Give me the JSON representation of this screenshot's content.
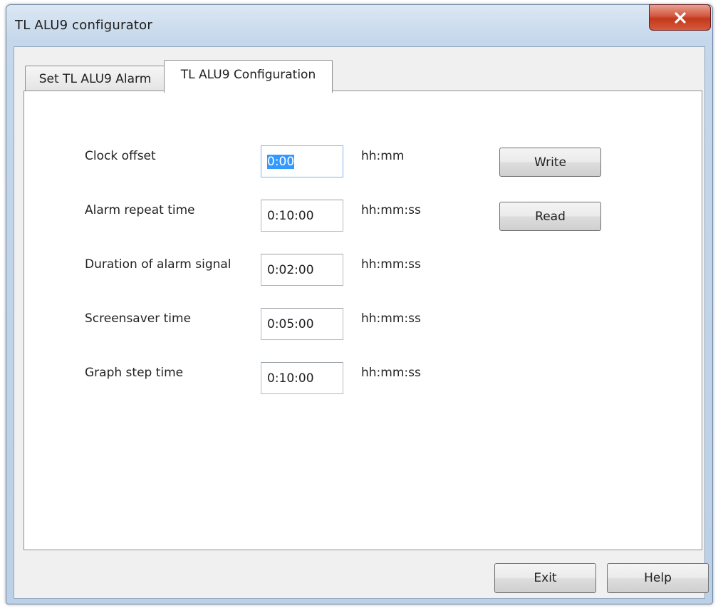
{
  "window": {
    "title": "TL ALU9 configurator"
  },
  "tabs": [
    {
      "label": "Set TL ALU9 Alarm",
      "active": false
    },
    {
      "label": "TL ALU9 Configuration",
      "active": true
    }
  ],
  "config": {
    "rows": [
      {
        "label": "Clock offset",
        "value": "0:00",
        "unit": "hh:mm"
      },
      {
        "label": "Alarm repeat time",
        "value": "0:10:00",
        "unit": "hh:mm:ss"
      },
      {
        "label": "Duration of alarm signal",
        "value": "0:02:00",
        "unit": "hh:mm:ss"
      },
      {
        "label": "Screensaver time",
        "value": "0:05:00",
        "unit": "hh:mm:ss"
      },
      {
        "label": "Graph step time",
        "value": "0:10:00",
        "unit": "hh:mm:ss"
      }
    ],
    "write_label": "Write",
    "read_label": "Read"
  },
  "footer": {
    "exit_label": "Exit",
    "help_label": "Help"
  },
  "icons": {
    "close": "close-icon"
  },
  "colors": {
    "close_button": "#c9442a",
    "selection": "#3399ff",
    "title_bar": "#c5d7ea"
  }
}
